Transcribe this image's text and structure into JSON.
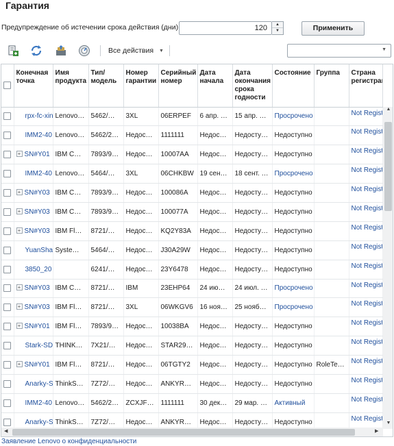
{
  "page": {
    "title": "Гарантия"
  },
  "warning": {
    "label": "Предупреждение об истечении срока действия (дни):",
    "days_value": "120",
    "apply_label": "Применить"
  },
  "toolbar": {
    "icons": [
      "export-icon",
      "refresh-icon",
      "transfer-icon",
      "gauge-icon"
    ],
    "actions_label": "Все действия",
    "filter_value": ""
  },
  "table": {
    "columns": [
      "",
      "Конечная точка",
      "Имя продукта",
      "Тип/ модель",
      "Номер гарантии",
      "Серийный номер",
      "Дата начала",
      "Дата окончания срока годности",
      "Состояние",
      "Группа",
      "Страна регистрации"
    ],
    "rows": [
      {
        "expand": false,
        "endpoint": "rpx-fc-xin",
        "product": "Lenovo…",
        "type": "5462/…",
        "warranty": "3XL",
        "serial": "06ERPEF",
        "start": "6 апр. …",
        "end": "15 апр. …",
        "status": "Просрочено",
        "status_blue": true,
        "group": "",
        "country": "Not Registered"
      },
      {
        "expand": false,
        "endpoint": "IMM2-40",
        "product": "Lenovo…",
        "type": "5462/2…",
        "warranty": "Недос…",
        "serial": "1111111",
        "start": "Недос…",
        "end": "Недосту…",
        "status": "Недоступно",
        "status_blue": false,
        "group": "",
        "country": "Not Registered"
      },
      {
        "expand": true,
        "endpoint": "SN#Y01",
        "product": "IBM C…",
        "type": "7893/9…",
        "warranty": "Недос…",
        "serial": "10007AA",
        "start": "Недос…",
        "end": "Недосту…",
        "status": "Недоступно",
        "status_blue": false,
        "group": "",
        "country": "Not Registered"
      },
      {
        "expand": false,
        "endpoint": "IMM2-40",
        "product": "Lenovo…",
        "type": "5464/…",
        "warranty": "3XL",
        "serial": "06CHKBW",
        "start": "19 сен…",
        "end": "18 сент. …",
        "status": "Просрочено",
        "status_blue": true,
        "group": "",
        "country": "Not Registered"
      },
      {
        "expand": true,
        "endpoint": "SN#Y03",
        "product": "IBM C…",
        "type": "7893/9…",
        "warranty": "Недос…",
        "serial": "100086A",
        "start": "Недос…",
        "end": "Недосту…",
        "status": "Недоступно",
        "status_blue": false,
        "group": "",
        "country": "Not Registered"
      },
      {
        "expand": true,
        "endpoint": "SN#Y03",
        "product": "IBM C…",
        "type": "7893/9…",
        "warranty": "Недос…",
        "serial": "100077A",
        "start": "Недос…",
        "end": "Недосту…",
        "status": "Недоступно",
        "status_blue": false,
        "group": "",
        "country": "Not Registered"
      },
      {
        "expand": true,
        "endpoint": "SN#Y03",
        "product": "IBM Fl…",
        "type": "8721/…",
        "warranty": "Недос…",
        "serial": "KQ2Y83A",
        "start": "Недос…",
        "end": "Недосту…",
        "status": "Недоступно",
        "status_blue": false,
        "group": "",
        "country": "Not Registered"
      },
      {
        "expand": false,
        "endpoint": "YuanSha",
        "product": "Syste…",
        "type": "5464/…",
        "warranty": "Недос…",
        "serial": "J30A29W",
        "start": "Недос…",
        "end": "Недосту…",
        "status": "Недоступно",
        "status_blue": false,
        "group": "",
        "country": "Not Registered"
      },
      {
        "expand": false,
        "endpoint": "3850_20",
        "product": "",
        "type": "6241/…",
        "warranty": "Недос…",
        "serial": "23Y6478",
        "start": "Недос…",
        "end": "Недосту…",
        "status": "Недоступно",
        "status_blue": false,
        "group": "",
        "country": "Not Registered"
      },
      {
        "expand": true,
        "endpoint": "SN#Y03",
        "product": "IBM C…",
        "type": "8721/…",
        "warranty": "IBM",
        "serial": "23EHP64",
        "start": "24 ию…",
        "end": "24 июл. …",
        "status": "Просрочено",
        "status_blue": true,
        "group": "",
        "country": "Not Registered"
      },
      {
        "expand": true,
        "endpoint": "SN#Y03",
        "product": "IBM Fl…",
        "type": "8721/…",
        "warranty": "3XL",
        "serial": "06WKGV6",
        "start": "16 ноя…",
        "end": "25 нояб…",
        "status": "Просрочено",
        "status_blue": true,
        "group": "",
        "country": "Not Registered"
      },
      {
        "expand": true,
        "endpoint": "SN#Y01",
        "product": "IBM Fl…",
        "type": "7893/9…",
        "warranty": "Недос…",
        "serial": "10038BA",
        "start": "Недос…",
        "end": "Недосту…",
        "status": "Недоступно",
        "status_blue": false,
        "group": "",
        "country": "Not Registered"
      },
      {
        "expand": false,
        "endpoint": "Stark-SD",
        "product": "THINK…",
        "type": "7X21/…",
        "warranty": "Недос…",
        "serial": "STAR29…",
        "start": "Недос…",
        "end": "Недосту…",
        "status": "Недоступно",
        "status_blue": false,
        "group": "",
        "country": "Not Registered"
      },
      {
        "expand": true,
        "endpoint": "SN#Y01",
        "product": "IBM Fl…",
        "type": "8721/…",
        "warranty": "Недос…",
        "serial": "06TGTY2",
        "start": "Недос…",
        "end": "Недосту…",
        "status": "Недоступно",
        "status_blue": false,
        "group": "RoleTe…",
        "country": "Not Registered"
      },
      {
        "expand": false,
        "endpoint": "Anarky-S",
        "product": "ThinkS…",
        "type": "7Z72/…",
        "warranty": "Недос…",
        "serial": "ANKYR…",
        "start": "Недос…",
        "end": "Недосту…",
        "status": "Недоступно",
        "status_blue": false,
        "group": "",
        "country": "Not Registered"
      },
      {
        "expand": false,
        "endpoint": "IMM2-40",
        "product": "Lenovo…",
        "type": "5462/2…",
        "warranty": "ZCXJF…",
        "serial": "1111111",
        "start": "30 дек…",
        "end": "29 мар. …",
        "status": "Активный",
        "status_blue": true,
        "group": "",
        "country": "Not Registered"
      },
      {
        "expand": false,
        "endpoint": "Anarky-S",
        "product": "ThinkS…",
        "type": "7Z72/…",
        "warranty": "Недос…",
        "serial": "ANKYR…",
        "start": "Недос…",
        "end": "Недосту…",
        "status": "Недоступно",
        "status_blue": false,
        "group": "",
        "country": "Not Registered"
      }
    ]
  },
  "footer": {
    "privacy_link": "Заявление Lenovo о конфиденциальности"
  },
  "colors": {
    "link": "#1f4f9c",
    "accent_green": "#3c8f3c",
    "accent_blue": "#3b78c2"
  }
}
